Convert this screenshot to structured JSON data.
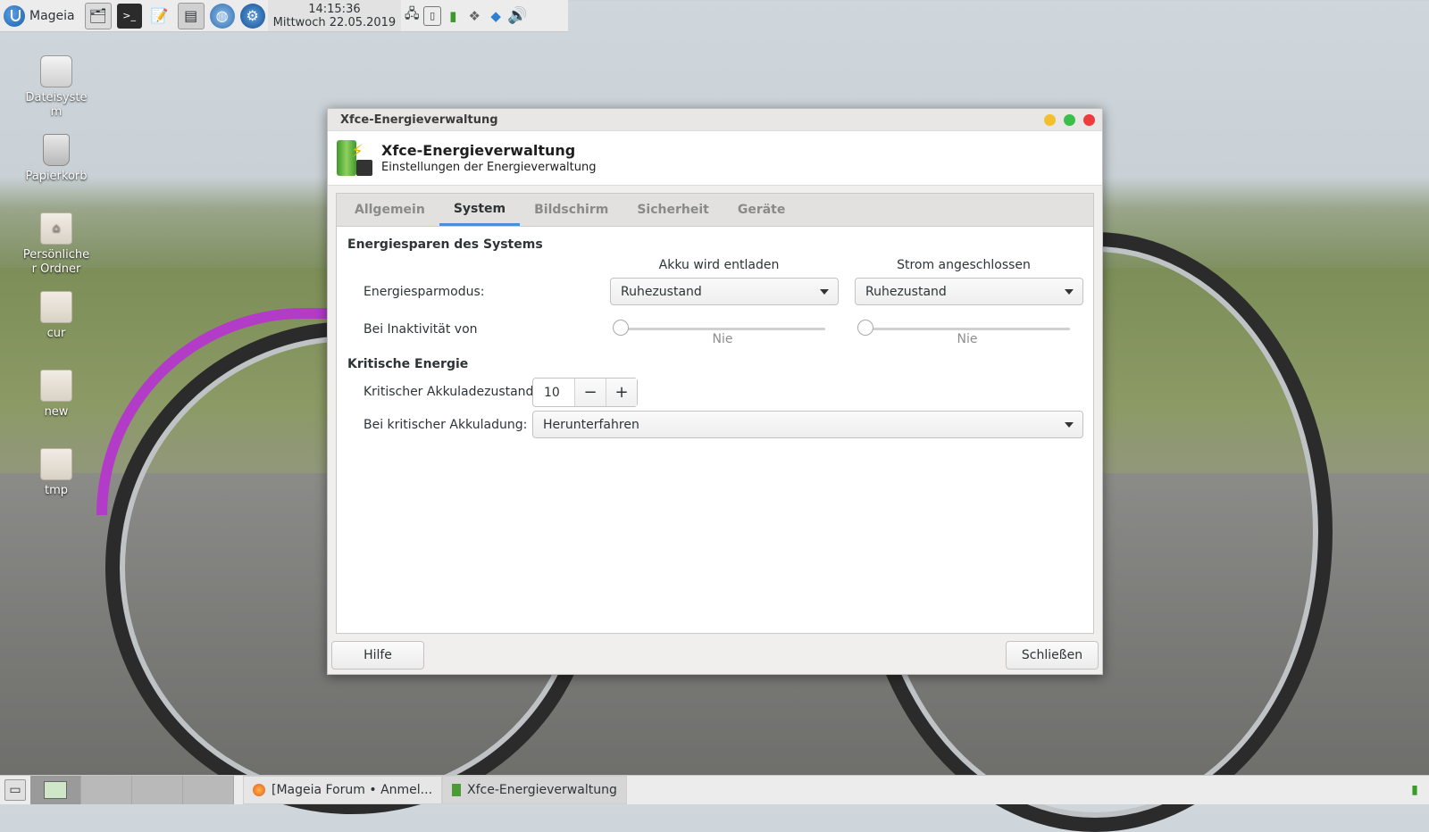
{
  "top_panel": {
    "menu_label": "Mageia",
    "clock_time": "14:15:36",
    "clock_date": "Mittwoch 22.05.2019",
    "launchers": [
      "file-manager-icon",
      "terminal-icon",
      "text-editor-icon",
      "settings-icon",
      "browser-icon",
      "system-config-icon"
    ],
    "tray": [
      "network-icon",
      "usb-icon",
      "power-manager-icon",
      "dropbox-icon",
      "bluetooth-icon",
      "volume-icon"
    ]
  },
  "desktop": {
    "icons": [
      {
        "label": "Dateisyste\nm"
      },
      {
        "label": "Papierkorb"
      },
      {
        "label": "Persönliche\nr Ordner"
      },
      {
        "label": "cur"
      },
      {
        "label": "new"
      },
      {
        "label": "tmp"
      }
    ]
  },
  "window": {
    "title": "Xfce-Energieverwaltung",
    "header_title": "Xfce-Energieverwaltung",
    "header_subtitle": "Einstellungen der Energieverwaltung",
    "tabs": [
      {
        "label": "Allgemein",
        "active": false
      },
      {
        "label": "System",
        "active": true
      },
      {
        "label": "Bildschirm",
        "active": false
      },
      {
        "label": "Sicherheit",
        "active": false
      },
      {
        "label": "Geräte",
        "active": false
      }
    ],
    "system": {
      "section_title": "Energiesparen des Systems",
      "col_battery": "Akku wird entladen",
      "col_ac": "Strom angeschlossen",
      "mode_label": "Energiesparmodus:",
      "mode_battery": "Ruhezustand",
      "mode_ac": "Ruhezustand",
      "inactivity_label": "Bei Inaktivität von",
      "inactivity_battery": "Nie",
      "inactivity_ac": "Nie",
      "critical_title": "Kritische Energie",
      "critical_level_label": "Kritischer Akkuladezustand:",
      "critical_level_value": "10",
      "critical_action_label": "Bei kritischer Akkuladung:",
      "critical_action_value": "Herunterfahren"
    },
    "help_button": "Hilfe",
    "close_button": "Schließen"
  },
  "taskbar": {
    "tasks": [
      {
        "label": "[Mageia Forum • Anmel...",
        "icon": "firefox-icon"
      },
      {
        "label": "Xfce-Energieverwaltung",
        "icon": "power-manager-icon"
      }
    ]
  }
}
